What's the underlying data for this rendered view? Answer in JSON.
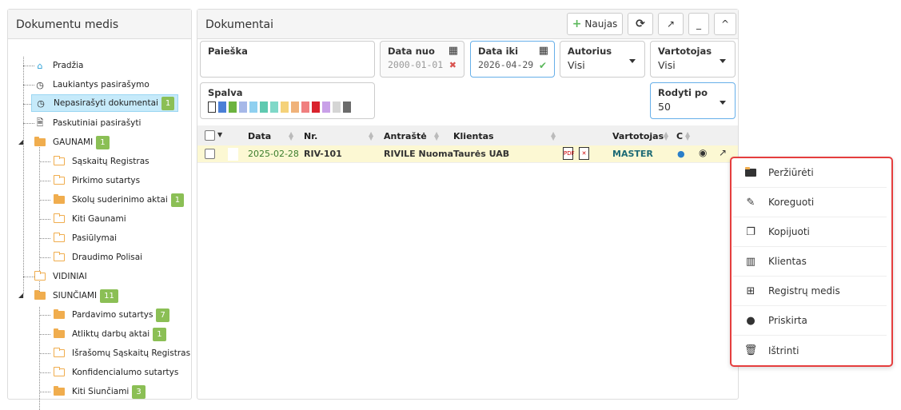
{
  "tree": {
    "title": "Dokumentu medis",
    "items": [
      {
        "label": "Pradžia"
      },
      {
        "label": "Laukiantys pasirašymo"
      },
      {
        "label": "Nepasirašyti dokumentai",
        "badge": "1"
      },
      {
        "label": "Paskutiniai pasirašyti"
      },
      {
        "label": "GAUNAMI",
        "badge": "1"
      },
      {
        "label": "Sąskaitų Registras"
      },
      {
        "label": "Pirkimo sutartys"
      },
      {
        "label": "Skolų suderinimo aktai",
        "badge": "1"
      },
      {
        "label": "Kiti Gaunami"
      },
      {
        "label": "Pasiūlymai"
      },
      {
        "label": "Draudimo Polisai"
      },
      {
        "label": "VIDINIAI"
      },
      {
        "label": "SIUNČIAMI",
        "badge": "11"
      },
      {
        "label": "Pardavimo sutartys",
        "badge": "7"
      },
      {
        "label": "Atliktų darbų aktai",
        "badge": "1"
      },
      {
        "label": "Išrašomų Sąskaitų Registras"
      },
      {
        "label": "Konfidencialumo sutartys"
      },
      {
        "label": "Kiti Siunčiami",
        "badge": "3"
      }
    ]
  },
  "main": {
    "title": "Dokumentai",
    "new_button": "Naujas",
    "minimize_label": "_",
    "collapse_label": "^"
  },
  "filters": {
    "search_label": "Paieška",
    "date_from_label": "Data nuo",
    "date_from_value": "2000-01-01",
    "date_to_label": "Data iki",
    "date_to_value": "2026-04-29",
    "author_label": "Autorius",
    "author_value": "Visi",
    "user_label": "Vartotojas",
    "user_value": "Visi",
    "color_label": "Spalva",
    "colors": [
      "#ffffff",
      "#4a7fd6",
      "#6cb33f",
      "#a6b8e8",
      "#8fd0f0",
      "#5fc9b0",
      "#7fd8c8",
      "#f5d27a",
      "#f0b27a",
      "#f07f7f",
      "#d9232d",
      "#c9a0e8",
      "#d5d5d5",
      "#6b6b6b"
    ],
    "show_label": "Rodyti po",
    "show_value": "50"
  },
  "table": {
    "columns": [
      "Data",
      "Nr.",
      "Antraštė",
      "Klientas",
      "Vartotojas",
      "C"
    ],
    "rows": [
      {
        "date": "2025-02-28",
        "nr": "RIV-101",
        "title": "RIVILE Nuoma",
        "client": "Taurės UAB",
        "user": "MASTER"
      }
    ]
  },
  "context_menu": {
    "items": [
      {
        "label": "Peržiūrėti",
        "icon": "folder-open-icon"
      },
      {
        "label": "Koreguoti",
        "icon": "edit-icon"
      },
      {
        "label": "Kopijuoti",
        "icon": "copy-icon"
      },
      {
        "label": "Klientas",
        "icon": "building-icon"
      },
      {
        "label": "Registrų medis",
        "icon": "sitemap-icon"
      },
      {
        "label": "Priskirta",
        "icon": "user-icon"
      },
      {
        "label": "Ištrinti",
        "icon": "trash-icon"
      }
    ]
  }
}
